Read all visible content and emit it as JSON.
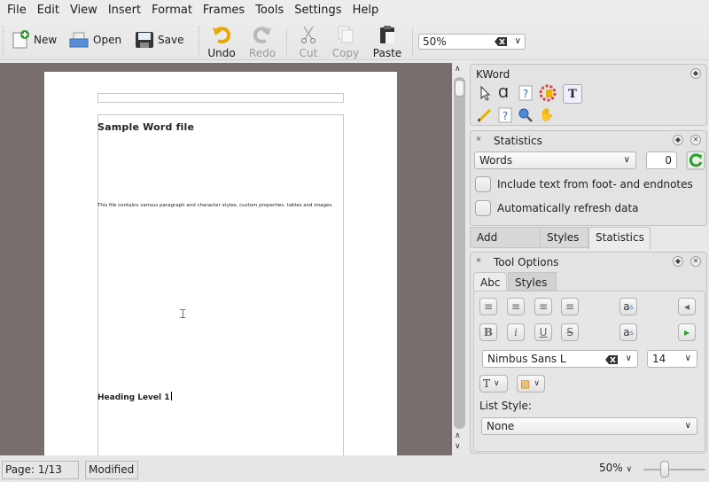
{
  "menubar": {
    "items": [
      "File",
      "Edit",
      "View",
      "Insert",
      "Format",
      "Frames",
      "Tools",
      "Settings",
      "Help"
    ]
  },
  "toolbar": {
    "new": "New",
    "open": "Open",
    "save": "Save",
    "undo": "Undo",
    "redo": "Redo",
    "cut": "Cut",
    "copy": "Copy",
    "paste": "Paste",
    "zoom_value": "50%"
  },
  "document": {
    "title": "Sample Word file",
    "body": "This file contains various paragraph and character styles, custom properties, tables and images.",
    "heading1": "Heading Level 1"
  },
  "kword_panel": {
    "title": "KWord",
    "tools": [
      "select-tool-icon",
      "path-tool-icon",
      "help-icon",
      "color-icon",
      "text-tool-icon",
      "pencil-icon",
      "help-icon",
      "zoom-icon",
      "pan-icon"
    ]
  },
  "statistics_panel": {
    "title": "Statistics",
    "mode": "Words",
    "count": "0",
    "include_footnotes_label": "Include text from foot- and endnotes",
    "include_footnotes_checked": false,
    "auto_refresh_label": "Automatically refresh data",
    "auto_refresh_checked": false
  },
  "dock_tabs": {
    "items": [
      "Add Shape",
      "Styles",
      "Statistics"
    ],
    "active": "Statistics"
  },
  "tool_options": {
    "title": "Tool Options",
    "tabs": [
      "Abc",
      "Styles"
    ],
    "active_tab": "Abc",
    "font_family": "Nimbus Sans L",
    "font_size": "14",
    "list_style_label": "List Style:",
    "list_style_value": "None"
  },
  "statusbar": {
    "page": "Page: 1/13",
    "modified": "Modified",
    "zoom": "50%",
    "zoom_slider_fraction": 0.3
  }
}
